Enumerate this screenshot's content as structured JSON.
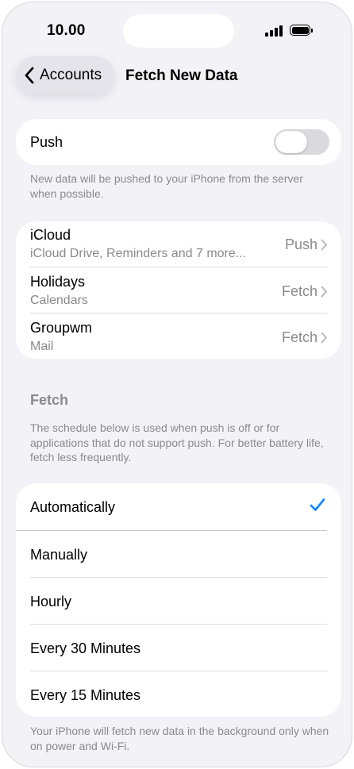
{
  "status_bar": {
    "time": "10.00"
  },
  "nav": {
    "back_label": "Accounts",
    "title": "Fetch New Data"
  },
  "push": {
    "label": "Push",
    "enabled": false,
    "footnote": "New data will be pushed to your iPhone from the server when possible."
  },
  "accounts": [
    {
      "name": "iCloud",
      "detail": "iCloud Drive, Reminders and 7 more...",
      "mode": "Push"
    },
    {
      "name": "Holidays",
      "detail": "Calendars",
      "mode": "Fetch"
    },
    {
      "name": "Groupwm",
      "detail": "Mail",
      "mode": "Fetch"
    }
  ],
  "fetch": {
    "header": "Fetch",
    "description": "The schedule below is used when push is off or for applications that do not support push. For better battery life, fetch less frequently.",
    "options": [
      "Automatically",
      "Manually",
      "Hourly",
      "Every 30 Minutes",
      "Every 15 Minutes"
    ],
    "selected": "Automatically",
    "footnote": "Your iPhone will fetch new data in the background only when on power and Wi-Fi."
  },
  "colors": {
    "accent": "#0a84ff",
    "background": "#f2f2f7",
    "secondary_text": "#8a8a8e"
  }
}
